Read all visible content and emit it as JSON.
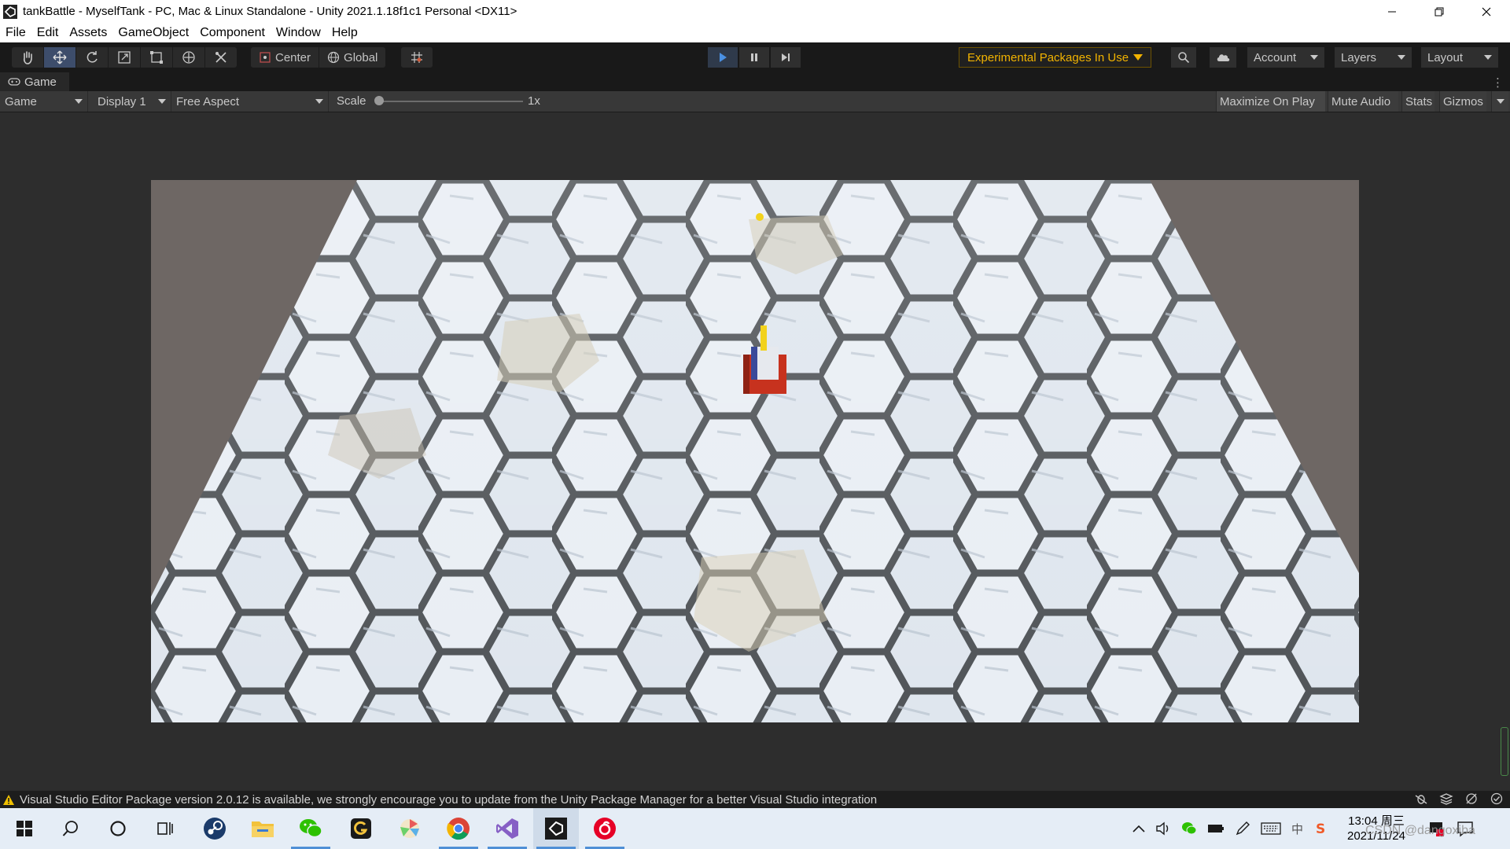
{
  "window": {
    "title": "tankBattle - MyselfTank - PC, Mac & Linux Standalone - Unity 2021.1.18f1c1 Personal <DX11>",
    "app_icon": "unity-logo-icon",
    "controls": [
      "minimize-icon",
      "restore-icon",
      "close-icon"
    ]
  },
  "menubar": {
    "items": [
      "File",
      "Edit",
      "Assets",
      "GameObject",
      "Component",
      "Window",
      "Help"
    ]
  },
  "toolbar": {
    "tools": [
      "hand-tool-icon",
      "move-tool-icon",
      "rotate-tool-icon",
      "scale-tool-icon",
      "rect-tool-icon",
      "transform-tool-icon",
      "custom-tool-icon"
    ],
    "active_tool": "move-tool-icon",
    "pivot_mode": "Center",
    "pivot_rotation": "Global",
    "snap_icon": "grid-snap-icon",
    "play_controls": [
      "play-icon",
      "pause-icon",
      "step-icon"
    ],
    "experimental_label": "Experimental Packages In Use",
    "account_label": "Account",
    "layers_label": "Layers",
    "layout_label": "Layout",
    "accent_color": "#f2b300"
  },
  "game_tab": {
    "label": "Game",
    "icon": "gamepad-icon"
  },
  "game_controls": {
    "view_select": "Game",
    "display_select": "Display 1",
    "aspect_select": "Free Aspect",
    "scale_label": "Scale",
    "scale_value": "1x",
    "scale_fraction": 0.0,
    "maximize_on_play": "Maximize On Play",
    "mute_audio": "Mute Audio",
    "stats": "Stats",
    "gizmos": "Gizmos"
  },
  "status": {
    "message": "Visual Studio Editor Package version 2.0.12 is available, we strongly encourage you to update from the Unity Package Manager for a better Visual Studio integration",
    "icon": "warning-icon",
    "warning_color": "#f0c000"
  },
  "taskbar": {
    "apps": [
      "windows-start-icon",
      "search-icon",
      "cortana-icon",
      "task-view-icon",
      "steam-icon",
      "file-explorer-icon",
      "wechat-icon",
      "grammarly-icon",
      "color-picker-icon",
      "chrome-icon",
      "visual-studio-icon",
      "unity-icon",
      "netease-music-icon"
    ],
    "tray_icons": [
      "chevron-up-icon",
      "volume-icon",
      "wechat-tray-icon",
      "battery-icon",
      "pen-icon",
      "keyboard-icon",
      "ime-icon",
      "sogou-icon"
    ],
    "ime_label": "中",
    "time": "13:04 周三",
    "date": "2021/11/24",
    "watermark": "CSDN @dangoxiba"
  }
}
